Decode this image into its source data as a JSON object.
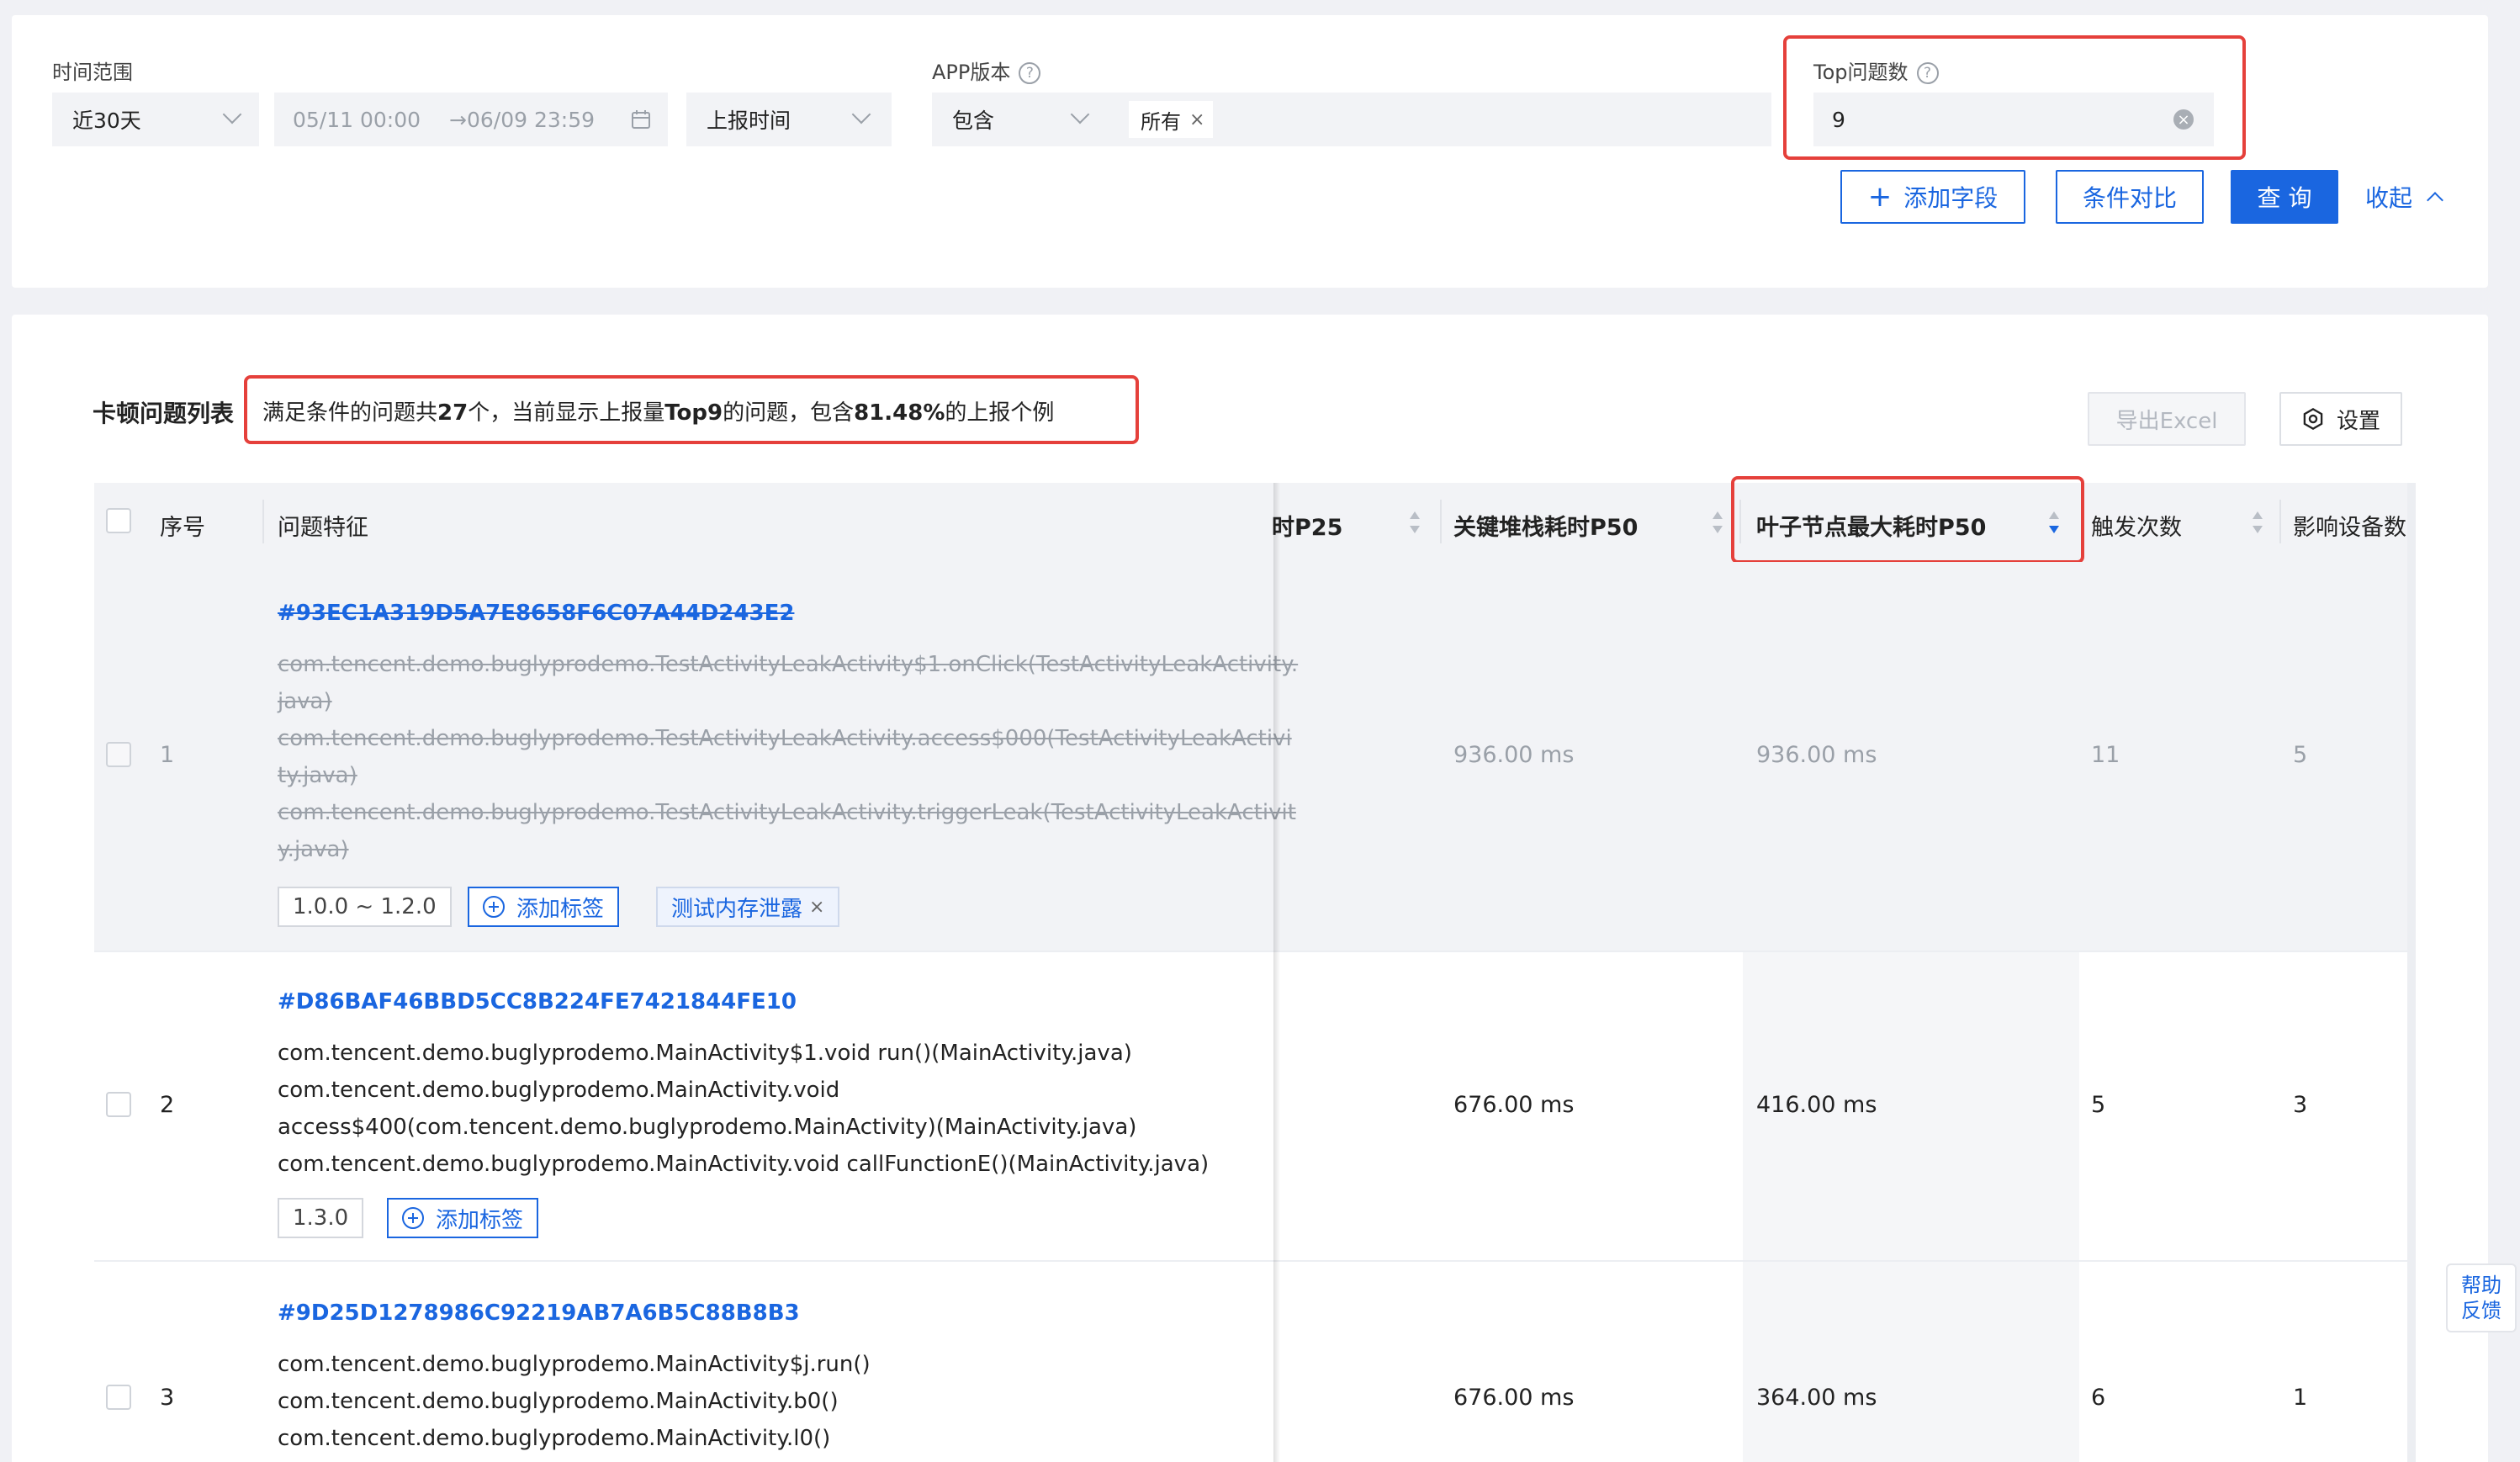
{
  "filters": {
    "time_range_label": "时间范围",
    "time_range_value": "近30天",
    "date_start": "05/11 00:00",
    "date_arrow": "→",
    "date_end": "06/09 23:59",
    "time_type": "上报时间",
    "app_version_label": "APP版本",
    "app_version_op": "包含",
    "app_version_tag": "所有",
    "top_label": "Top问题数",
    "top_value": "9"
  },
  "actions": {
    "add_field": "添加字段",
    "compare": "条件对比",
    "query": "查 询",
    "collapse": "收起"
  },
  "list": {
    "title": "卡顿问题列表",
    "summary_prefix": "满足条件的问题共",
    "summary_count": "27",
    "summary_mid": "个，当前显示上报量",
    "summary_top": "Top9",
    "summary_mid2": "的问题，包含",
    "summary_pct": "81.48%",
    "summary_suffix": "的上报个例",
    "export": "导出Excel",
    "settings": "设置"
  },
  "columns": {
    "index": "序号",
    "feature": "问题特征",
    "p25": "时P25",
    "stack_p50": "关键堆栈耗时P50",
    "leaf_p50": "叶子节点最大耗时P50",
    "trigger": "触发次数",
    "devices": "影响设备数"
  },
  "rows": [
    {
      "index": "1",
      "hash": "#93EC1A319D5A7E8658F6C07A44D243E2",
      "stack": [
        "com.tencent.demo.buglyprodemo.TestActivityLeakActivity$1.onClick(TestActivityLeakActivity.",
        "java)",
        "com.tencent.demo.buglyprodemo.TestActivityLeakActivity.access$000(TestActivityLeakActivi",
        "ty.java)",
        "com.tencent.demo.buglyprodemo.TestActivityLeakActivity.triggerLeak(TestActivityLeakActivit",
        "y.java)"
      ],
      "version": "1.0.0 ~ 1.2.0",
      "add_tag": "添加标签",
      "custom_tag": "测试内存泄露",
      "stack_p50": "936.00 ms",
      "leaf_p50": "936.00 ms",
      "trigger": "11",
      "devices": "5"
    },
    {
      "index": "2",
      "hash": "#D86BAF46BBD5CC8B224FE7421844FE10",
      "stack": [
        "com.tencent.demo.buglyprodemo.MainActivity$1.void run()(MainActivity.java)",
        "com.tencent.demo.buglyprodemo.MainActivity.void",
        "access$400(com.tencent.demo.buglyprodemo.MainActivity)(MainActivity.java)",
        "com.tencent.demo.buglyprodemo.MainActivity.void callFunctionE()(MainActivity.java)"
      ],
      "version": "1.3.0",
      "add_tag": "添加标签",
      "stack_p50": "676.00 ms",
      "leaf_p50": "416.00 ms",
      "trigger": "5",
      "devices": "3"
    },
    {
      "index": "3",
      "hash": "#9D25D1278986C92219AB7A6B5C88B8B3",
      "stack": [
        "com.tencent.demo.buglyprodemo.MainActivity$j.run()",
        "com.tencent.demo.buglyprodemo.MainActivity.b0()",
        "com.tencent.demo.buglyprodemo.MainActivity.l0()"
      ],
      "stack_p50": "676.00 ms",
      "leaf_p50": "364.00 ms",
      "trigger": "6",
      "devices": "1"
    }
  ],
  "help": {
    "line1": "帮助",
    "line2": "反馈"
  },
  "colors": {
    "accent": "#1a66e0",
    "highlight": "#e5403b"
  }
}
